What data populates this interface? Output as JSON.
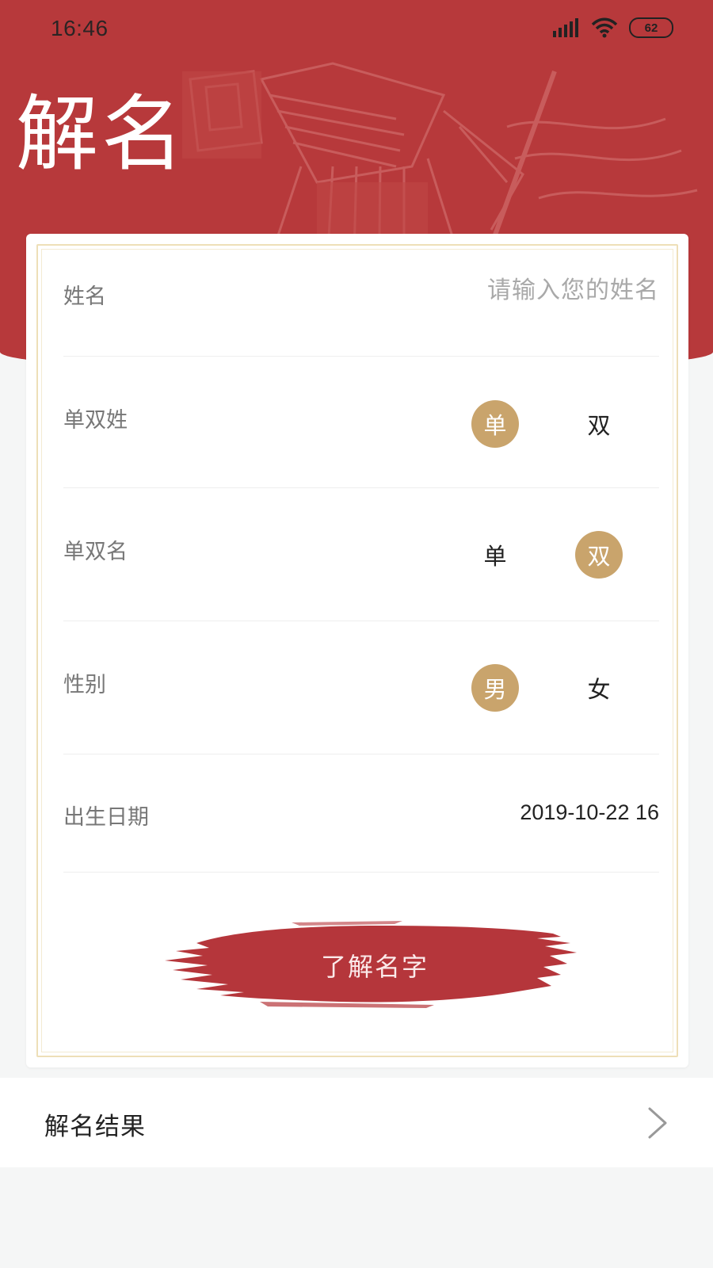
{
  "status_bar": {
    "time": "16:46",
    "battery": "62",
    "icons": [
      "signal-icon",
      "wifi-icon",
      "battery-icon"
    ]
  },
  "header": {
    "title": "解名"
  },
  "form": {
    "name": {
      "label": "姓名",
      "placeholder": "请输入您的姓名",
      "value": ""
    },
    "surname_type": {
      "label": "单双姓",
      "options": [
        "单",
        "双"
      ],
      "selected": "单"
    },
    "given_name_type": {
      "label": "单双名",
      "options": [
        "单",
        "双"
      ],
      "selected": "双"
    },
    "gender": {
      "label": "性别",
      "options": [
        "男",
        "女"
      ],
      "selected": "男"
    },
    "birth_date": {
      "label": "出生日期",
      "value": "2019-10-22 16"
    },
    "submit_label": "了解名字"
  },
  "result": {
    "label": "解名结果",
    "icon": "chevron-right-icon"
  },
  "colors": {
    "header_red": "#b7393b",
    "accent_gold": "#c9a46c",
    "brush_red": "#b5363b",
    "background": "#f5f6f6"
  }
}
